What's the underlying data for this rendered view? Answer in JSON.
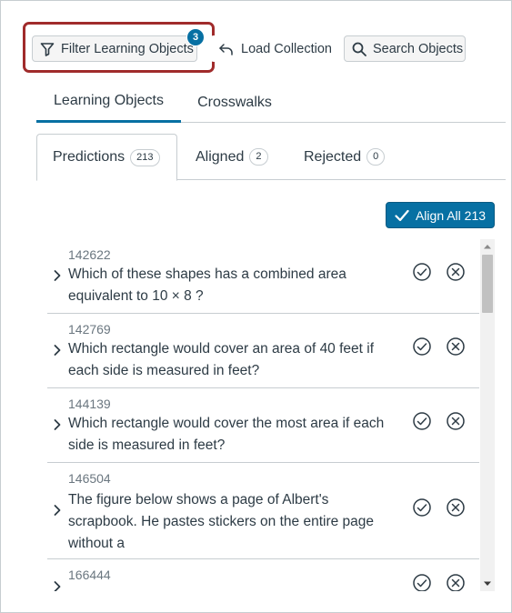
{
  "toolbar": {
    "filter_label": "Filter Learning Objects",
    "filter_count": "3",
    "load_label": "Load Collection",
    "search_label": "Search Objects"
  },
  "primary_tabs": [
    {
      "label": "Learning Objects",
      "active": true
    },
    {
      "label": "Crosswalks",
      "active": false
    }
  ],
  "secondary_tabs": [
    {
      "label": "Predictions",
      "count": "213",
      "active": true
    },
    {
      "label": "Aligned",
      "count": "2",
      "active": false
    },
    {
      "label": "Rejected",
      "count": "0",
      "active": false
    }
  ],
  "align_all_label": "Align All 213",
  "items": [
    {
      "id": "142622",
      "lines": [
        "Which of these shapes has a combined area",
        "equivalent to 10 × 8 ?"
      ]
    },
    {
      "id": "142769",
      "lines": [
        "Which rectangle would cover an area of 40 feet if",
        "each side is measured in feet?"
      ]
    },
    {
      "id": "144139",
      "lines": [
        "Which rectangle would cover the most area if each",
        "side is measured in feet?"
      ]
    },
    {
      "id": "146504",
      "lines": [
        "The figure below shows a page of Albert's",
        "scrapbook. He pastes stickers on the entire page",
        "without a"
      ]
    },
    {
      "id": "166444",
      "lines": []
    }
  ],
  "colors": {
    "accent": "#0770a3",
    "highlight": "#a02b2b",
    "border": "#c7cdd1",
    "text": "#2d3b45",
    "muted": "#6b7780"
  },
  "icons": {
    "filter": "filter-icon",
    "load": "undo-arrow-icon",
    "search": "search-icon",
    "align": "check-icon",
    "expand": "chevron-right-icon",
    "accept": "check-circle-icon",
    "reject": "x-circle-icon"
  }
}
